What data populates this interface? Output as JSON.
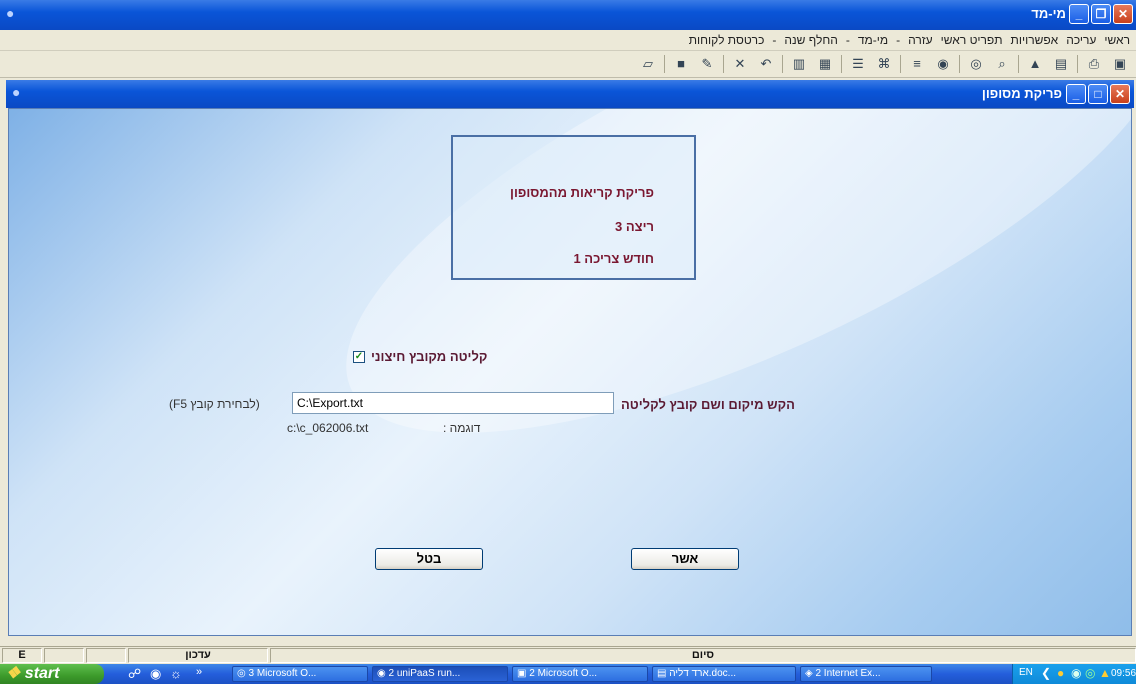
{
  "colors": {
    "titlebar": "#0a55d8",
    "label": "#7a1730",
    "client_bg": "#cfe3f7"
  },
  "outer_window": {
    "title": "מי-מד"
  },
  "menu": {
    "items": [
      "ראשי",
      "עריכה",
      "אפשרויות",
      "תפריט ראשי",
      "עזרה",
      "-",
      "מי-מד",
      "-",
      "החלף שנה",
      "-",
      "כרטסת לקוחות"
    ]
  },
  "toolbar_icons": [
    "save-icon",
    "print-icon",
    "window-icon",
    "window-up-icon",
    "zoom-icon",
    "binoculars-icon",
    "binoculars2-icon",
    "sort-icon",
    "search-icon",
    "list-icon",
    "paste-icon",
    "copy-icon",
    "undo-icon",
    "delete-icon",
    "edit-icon",
    "stamp-icon",
    "open-icon"
  ],
  "inner_window": {
    "title": "פריקת מסופון"
  },
  "info": {
    "line1": "פריקת קריאות מהמסופון",
    "line2": "ריצה  3",
    "line3": "חודש צריכה  1"
  },
  "form": {
    "checkbox_label": "קליטה מקובץ חיצוני",
    "checkbox_checked": true,
    "path_label": "הקש מיקום ושם קובץ לקליטה",
    "path_value": "C:\\Export.txt",
    "f5_hint": "(F5 לבחירת קובץ)",
    "example_label": "דוגמה   :",
    "example_value": "c:\\c_062006.txt"
  },
  "buttons": {
    "ok": "אשר",
    "cancel": "בטל"
  },
  "status": {
    "cell1": "E",
    "cell2": "עדכון",
    "cell3": "סיום"
  },
  "taskbar": {
    "start": "start",
    "tasks": [
      "3 Microsoft O...",
      "2 uniPaaS run...",
      "2 Microsoft O...",
      "ארד דליה.doc...",
      "2 Internet Ex..."
    ],
    "lang": "EN",
    "clock": "09:56"
  }
}
